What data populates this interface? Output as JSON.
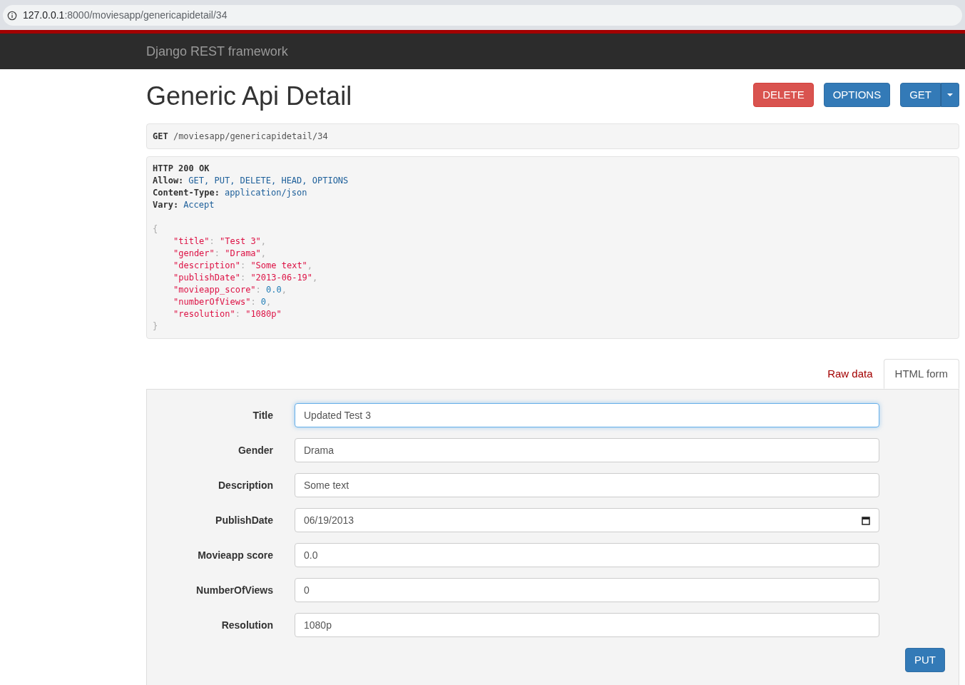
{
  "browser": {
    "url_host": "127.0.0.1",
    "url_rest": ":8000/moviesapp/genericapidetail/34"
  },
  "navbar": {
    "brand": "Django REST framework"
  },
  "page": {
    "title": "Generic Api Detail"
  },
  "actions": [
    {
      "label": "DELETE",
      "kind": "danger"
    },
    {
      "label": "OPTIONS",
      "kind": "primary"
    },
    {
      "label": "GET",
      "kind": "split"
    }
  ],
  "request": {
    "method": "GET",
    "path": "/moviesapp/genericapidetail/34"
  },
  "response": {
    "status": "HTTP 200 OK",
    "headers": [
      {
        "name": "Allow:",
        "value": "GET, PUT, DELETE, HEAD, OPTIONS"
      },
      {
        "name": "Content-Type:",
        "value": "application/json"
      },
      {
        "name": "Vary:",
        "value": "Accept"
      }
    ],
    "open_brace": "{",
    "close_brace": "}",
    "body": [
      {
        "key": "\"title\"",
        "sep": ": ",
        "value": "\"Test 3\"",
        "kind": "string",
        "trail": ","
      },
      {
        "key": "\"gender\"",
        "sep": ": ",
        "value": "\"Drama\"",
        "kind": "string",
        "trail": ","
      },
      {
        "key": "\"description\"",
        "sep": ": ",
        "value": "\"Some text\"",
        "kind": "string",
        "trail": ","
      },
      {
        "key": "\"publishDate\"",
        "sep": ": ",
        "value": "\"2013-06-19\"",
        "kind": "string",
        "trail": ","
      },
      {
        "key": "\"movieapp_score\"",
        "sep": ": ",
        "value": "0.0",
        "kind": "number",
        "trail": ","
      },
      {
        "key": "\"numberOfViews\"",
        "sep": ": ",
        "value": "0",
        "kind": "number",
        "trail": ","
      },
      {
        "key": "\"resolution\"",
        "sep": ": ",
        "value": "\"1080p\"",
        "kind": "string"
      }
    ]
  },
  "tabs": [
    {
      "label": "Raw data",
      "selected": false
    },
    {
      "label": "HTML form",
      "selected": true
    }
  ],
  "form": {
    "fields": [
      {
        "label": "Title",
        "value": "Updated Test 3",
        "kind": "text",
        "focused": true
      },
      {
        "label": "Gender",
        "value": "Drama",
        "kind": "text",
        "focused": false
      },
      {
        "label": "Description",
        "value": "Some text",
        "kind": "text",
        "focused": false
      },
      {
        "label": "PublishDate",
        "value": "06/19/2013",
        "kind": "date",
        "focused": false
      },
      {
        "label": "Movieapp score",
        "value": "0.0",
        "kind": "text",
        "focused": false
      },
      {
        "label": "NumberOfViews",
        "value": "0",
        "kind": "text",
        "focused": false
      },
      {
        "label": "Resolution",
        "value": "1080p",
        "kind": "text",
        "focused": false
      }
    ],
    "submit": "PUT"
  }
}
